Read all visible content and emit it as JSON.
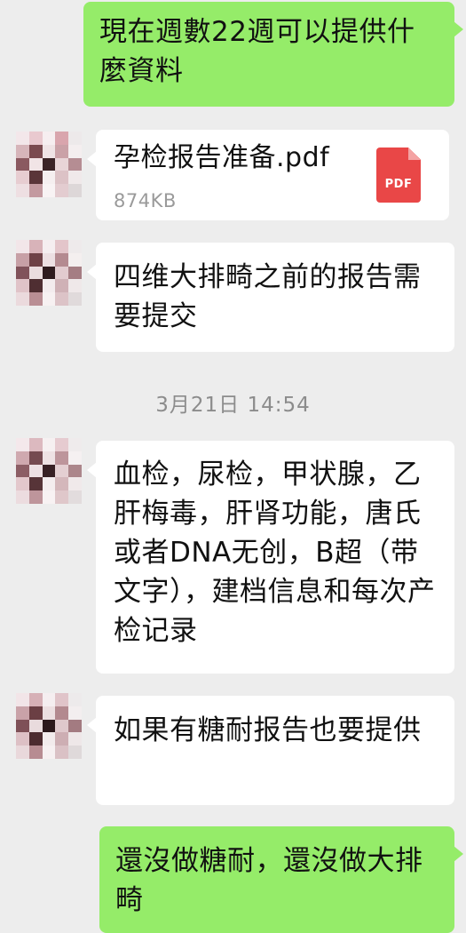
{
  "messages": {
    "m1": "現在週數22週可以提供什麼資料",
    "file": {
      "name": "孕检报告准备.pdf",
      "size": "874KB",
      "icon_label": "PDF"
    },
    "m2": "四维大排畸之前的报告需要提交",
    "timestamp": "3月21日 14:54",
    "m3": "血检，尿检，甲状腺，乙肝梅毒，肝肾功能，唐氏或者DNA无创，B超（带文字），建档信息和每次产检记录",
    "m4": "如果有糖耐报告也要提供",
    "m5": "還沒做糖耐，還沒做大排畸"
  },
  "colors": {
    "outgoing": "#95ec69",
    "incoming": "#ffffff",
    "background": "#ededed",
    "pdf": "#e94747"
  }
}
